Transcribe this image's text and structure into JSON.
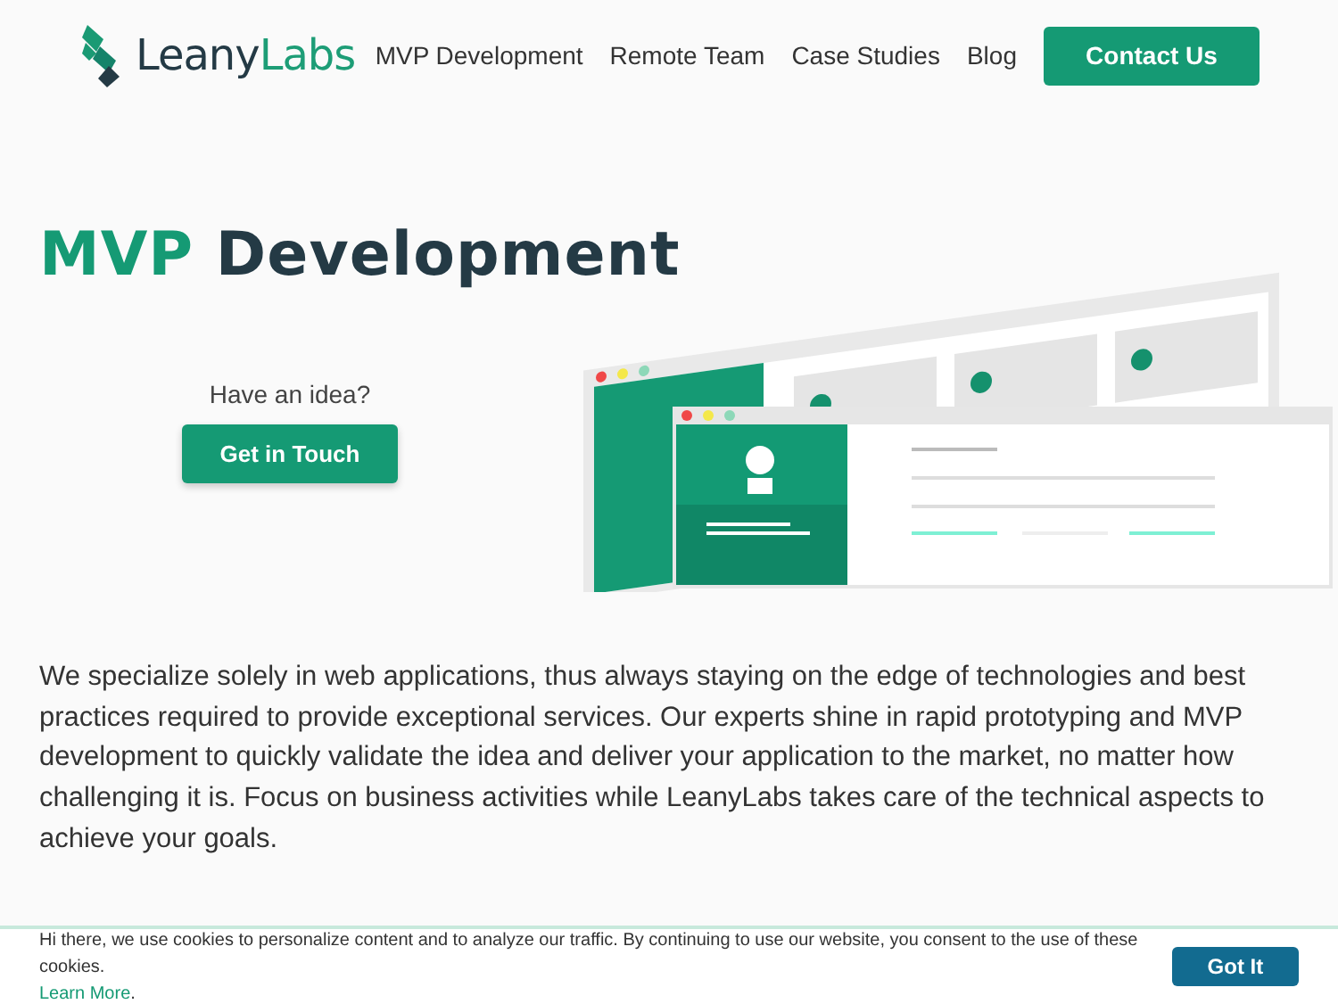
{
  "header": {
    "logo": {
      "part_1": "Leany",
      "part_2": "Labs"
    },
    "nav": [
      {
        "label": "MVP Development"
      },
      {
        "label": "Remote Team"
      },
      {
        "label": "Case Studies"
      },
      {
        "label": "Blog"
      }
    ],
    "cta": "Contact Us"
  },
  "hero": {
    "title_accent": "MVP",
    "title_rest": "Development",
    "prompt": "Have an idea?",
    "button": "Get in Touch"
  },
  "description": "We specialize solely in web applications, thus always staying on the edge of technologies and best practices required to provide exceptional services. Our experts shine in rapid prototyping and MVP development to quickly validate the idea and deliver your application to the market, no matter how challenging it is. Focus on business activities while LeanyLabs takes care of the technical aspects to achieve your goals.",
  "cookie_bar": {
    "text": "Hi there, we use cookies to personalize content and to analyze our traffic. By continuing to use our website, you consent to the use of these cookies.",
    "link": "Learn More",
    "link_suffix": ".",
    "button": "Got It"
  }
}
